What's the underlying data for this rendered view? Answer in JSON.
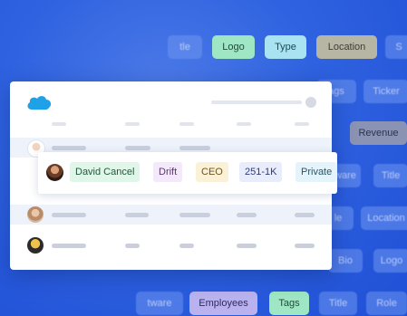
{
  "background_chips": {
    "row1": [
      "tle",
      "Logo",
      "Type",
      "Location",
      "S"
    ],
    "row2": [
      "ags",
      "Ticker"
    ],
    "row3": [
      "Revenue"
    ],
    "row4": [
      "ware",
      "Title"
    ],
    "row5": [
      "le",
      "Location"
    ],
    "row6": [
      "Bio",
      "Logo"
    ],
    "row7": [
      "tware",
      "Employees",
      "Tags",
      "Title",
      "Role"
    ]
  },
  "card": {
    "logo": "cloud-logo"
  },
  "highlighted_row": {
    "name": "David Cancel",
    "company": "Drift",
    "title": "CEO",
    "size": "251-1K",
    "status": "Private"
  },
  "colors": {
    "accent_blue": "#2f62e0",
    "logo_blue": "#1ea1e6"
  }
}
